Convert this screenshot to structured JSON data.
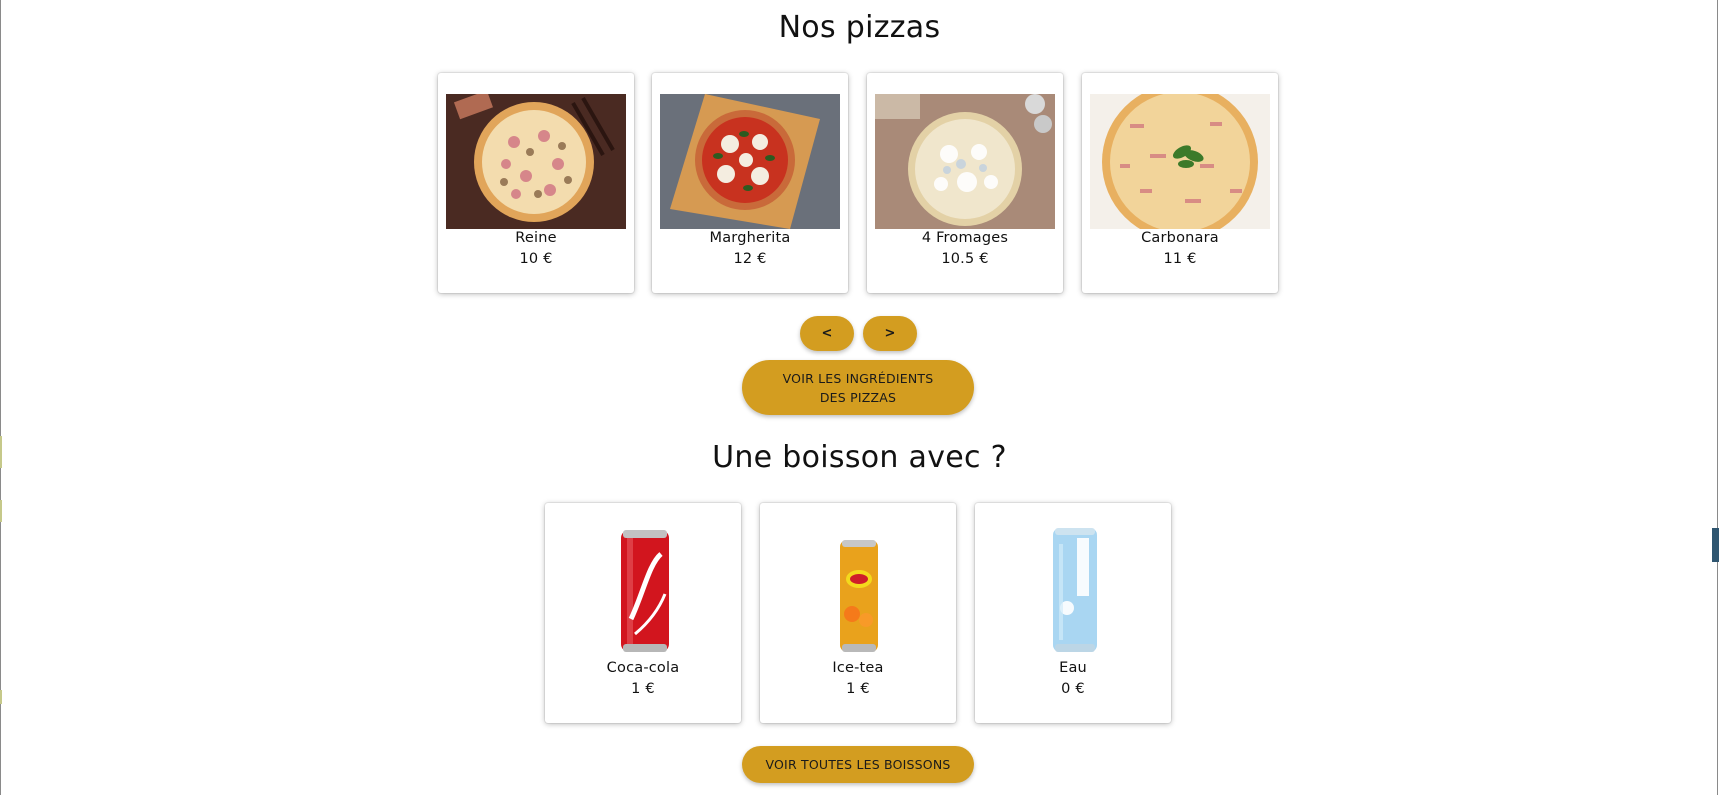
{
  "pizzas_section": {
    "title": "Nos pizzas",
    "items": [
      {
        "name": "Reine",
        "price": "10 €",
        "image": "pizza-reine-image"
      },
      {
        "name": "Margherita",
        "price": "12 €",
        "image": "pizza-margherita-image"
      },
      {
        "name": "4 Fromages",
        "price": "10.5 €",
        "image": "pizza-4-fromages-image"
      },
      {
        "name": "Carbonara",
        "price": "11 €",
        "image": "pizza-carbonara-image"
      }
    ],
    "prev_label": "<",
    "next_label": ">",
    "ingredients_button": "VOIR LES INGRÉDIENTS DES PIZZAS"
  },
  "drinks_section": {
    "title": "Une boisson avec ?",
    "items": [
      {
        "name": "Coca-cola",
        "price": "1 €",
        "image": "coca-cola-can-image"
      },
      {
        "name": "Ice-tea",
        "price": "1 €",
        "image": "ice-tea-can-image"
      },
      {
        "name": "Eau",
        "price": "0 €",
        "image": "water-can-image"
      }
    ],
    "all_drinks_button": "VOIR TOUTES LES BOISSONS"
  },
  "colors": {
    "accent": "#d39d20",
    "text": "#111111",
    "card_background": "#ffffff"
  }
}
